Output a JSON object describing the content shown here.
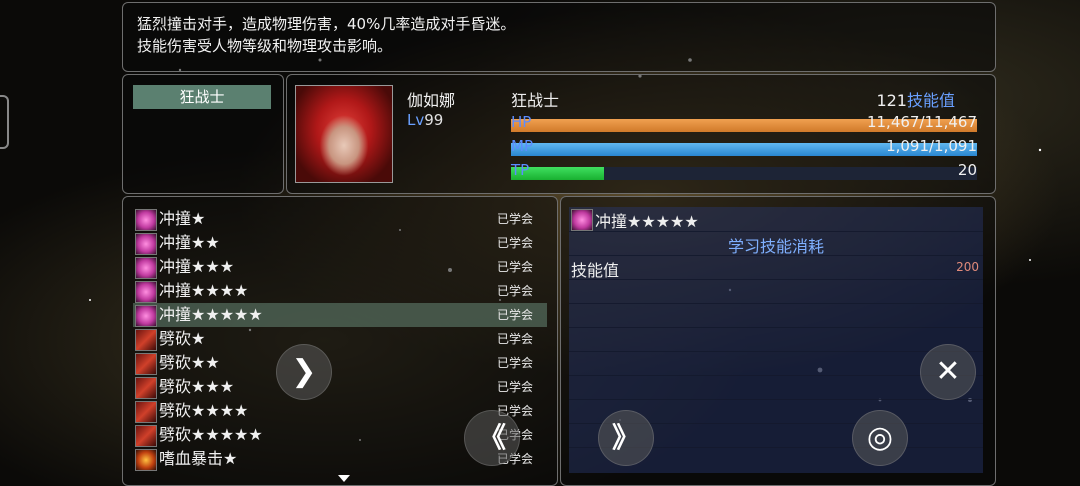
{
  "description": {
    "line1": "猛烈撞击对手，造成物理伤害，40%几率造成对手昏迷。",
    "line2": "技能伤害受人物等级和物理攻击影响。"
  },
  "class_tab": {
    "label": "狂战士"
  },
  "character": {
    "name": "伽如娜",
    "level_prefix": "Lv",
    "level": "99",
    "class": "狂战士",
    "skill_points_value": "121",
    "skill_points_label": "技能值",
    "hp_label": "HP",
    "hp_value": "11,467/11,467",
    "hp_fraction": 1.0,
    "mp_label": "MP",
    "mp_value": "1,091/1,091",
    "mp_fraction": 1.0,
    "tp_label": "TP",
    "tp_value": "20",
    "tp_fraction": 0.2
  },
  "skills": [
    {
      "name": "冲撞★",
      "status": "已学会",
      "icon": "pink"
    },
    {
      "name": "冲撞★★",
      "status": "已学会",
      "icon": "pink"
    },
    {
      "name": "冲撞★★★",
      "status": "已学会",
      "icon": "pink"
    },
    {
      "name": "冲撞★★★★",
      "status": "已学会",
      "icon": "pink"
    },
    {
      "name": "冲撞★★★★★",
      "status": "已学会",
      "icon": "pink"
    },
    {
      "name": "劈砍★",
      "status": "已学会",
      "icon": "red"
    },
    {
      "name": "劈砍★★",
      "status": "已学会",
      "icon": "red"
    },
    {
      "name": "劈砍★★★",
      "status": "已学会",
      "icon": "red"
    },
    {
      "name": "劈砍★★★★",
      "status": "已学会",
      "icon": "red"
    },
    {
      "name": "劈砍★★★★★",
      "status": "已学会",
      "icon": "red"
    },
    {
      "name": "嗜血暴击★",
      "status": "已学会",
      "icon": "orange"
    }
  ],
  "detail": {
    "skill_name": "冲撞★★★★★",
    "subtitle": "学习技能消耗",
    "cost_label": "技能值",
    "cost_value": "200"
  },
  "buttons": {
    "next": "❯",
    "fast_forward": "《",
    "skip": "》",
    "close": "✕",
    "confirm": "◎"
  }
}
